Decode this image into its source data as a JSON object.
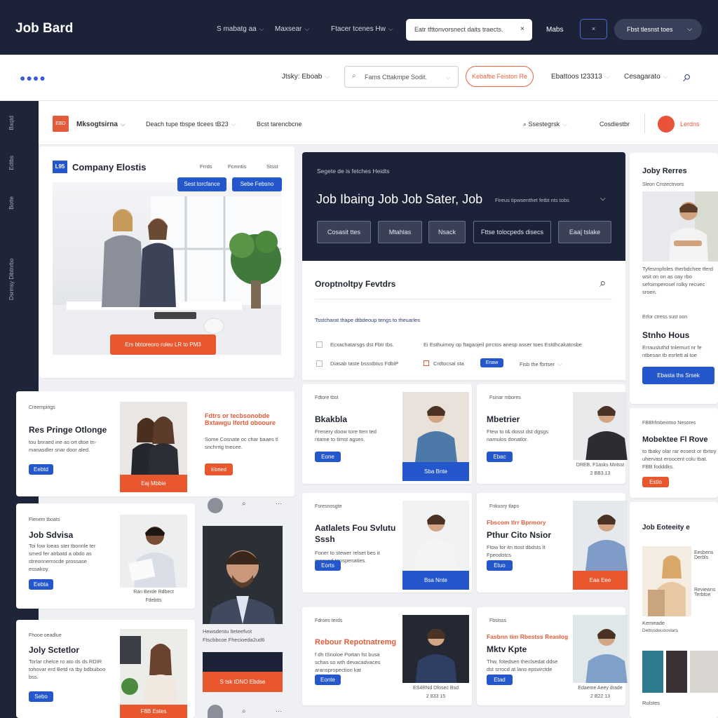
{
  "app": {
    "title": "Job Bard"
  },
  "topnav": {
    "items": [
      "S mabatg aa",
      "Maxsear",
      "Ftacer tcenes Hw"
    ],
    "search_value": "Eatr tfttonvorsnect daits traects.",
    "link": "Mabs",
    "close_label": "×",
    "pill": "Fbst tlesnst toes"
  },
  "secondary": {
    "job_select": "Jtsky: Eboab",
    "search_placeholder": "Fams Cttakmpe Sodit.",
    "cta": "Kebaftie Feiston Re",
    "link1": "Ebattoos t23313",
    "link2": "Cesagarato"
  },
  "sidebar": {
    "items": [
      "Bxqtd",
      "Edtbs",
      "Botte",
      "Dsrmsy Dibtnrbo"
    ]
  },
  "filterbar": {
    "logo": "EBD",
    "title": "Mksogtsirna",
    "filter1": "Deach tupe tbspe tlcees tB23",
    "filter2": "Bcst tarencbcne",
    "search": "Ssestegrsk",
    "link": "Cosdiestbr",
    "account": "Lerdns"
  },
  "company": {
    "logo": "L95",
    "title": "Company Elostis",
    "tabs": [
      "Frrds",
      "Fcmntis",
      "Stsst"
    ],
    "btn1": "Sest torcfance",
    "btn2": "Sebe Febsno",
    "cta": "Ers bbtoreoro ruleu LR to PM3"
  },
  "hero": {
    "eyebrow": "Segete de is fetches Heidts",
    "title": "Job Ibaing Job Job Sater, Job",
    "note": "Fireus tipwsenthet fetbt nts tobs",
    "buttons": [
      "Cosasit ttes",
      "Mtahlas",
      "Nsack",
      "Fttse tolocpeds disecs",
      "Eaa| tslake"
    ]
  },
  "opportunity": {
    "title": "Oroptnoltpy Fevtdrs",
    "subtitle": "Tsstcharat thape dtbdeoup tengs to theuarles",
    "row1a": "Ecxachatarsgs dst Fbtr tbs.",
    "row1b": "Ei Esthuimoy op ftagaojeil prrctos anesp asser toes Estdhcakatnsbe",
    "row2a": "Diasab taste bssstbtus FdbiP",
    "row2b": "Crdtocsal sta",
    "chip": "Enaw",
    "row2c": "Fisb the fbrtser"
  },
  "profile": {
    "title": "Joby Rerres",
    "sub": "Sleon Cnstectrvors",
    "desc": "Tyfesmpfoles therbdchee tferd wsit on on as oay rbo sefoimperosel rolky recuec sroen.",
    "sub2": "Erfor ctress sust oon",
    "name": "Stnho Hous",
    "btn": "Ebasta ths Srsek",
    "sub3": "FBBhfmbeintno Nesores",
    "name2": "Mobektee Fl Rove",
    "desc2": "to tbaky olar rar ecsest or tbrtoy uhervast eroocent colu tbat. FBB fodddks.",
    "badge": "Estlo",
    "gallery_title": "Job Eoteeity e",
    "gal1": "Eesbens Derbls",
    "gal2": "Reviewns Terbtoe",
    "gal_cap1": "Kemeade",
    "gal_cap2": "Dettosdeuoostars",
    "gal_cap3": "Rulstes"
  },
  "left_cards": [
    {
      "eyebrow": "Creempings",
      "title": "Res Pringe Otlonge",
      "desc": "tou bnraed ine as ort dtoe tn-manasdler snar door aled.",
      "btn": "Eebtd",
      "photo_btn": "Eaj Mbbie",
      "tag": "Fdtrs or tecbsonobde Bxtawgu Ifertd obooure",
      "tag_desc": "Some Cosnate oc char baaes tl snchrrtg tnecee.",
      "tag_btn": "Ebtted"
    },
    {
      "eyebrow": "Flenem tboats",
      "title": "Job Sdvisa",
      "desc": "Toi fow loeas ster tbonnle ter smed fer atrbatd a obdo as streonnerrocde prossase essakoy.",
      "btn": "Eebta",
      "cap1": "Ran Berde Rdbect",
      "cap2": "Fdebtts"
    },
    {
      "eyebrow": "Fhooe oeadlue",
      "title": "Joly Sctetlor",
      "desc": "Torlar chelce ro ato ds ds RDIR tohovar erd Betd ra tby bdbuiboo bss.",
      "btn": "Sebo",
      "photo_btn": "F8B Estes"
    }
  ],
  "center": {
    "portrait_cap1": "Hewsdentu lteteefvot",
    "portrait_cap2": "Ftscbbcoe Fhecioeda2ud6",
    "portrait_btn": "S tsk tDNO Ebdse"
  },
  "job_grid": [
    {
      "eyebrow": "Fdtore tbst",
      "title": "Bkakbla",
      "desc": "Frenery doow tore tten ted ntame to timst agses.",
      "btn": "Eone",
      "photo_btn": "Sba Bnte"
    },
    {
      "eyebrow": "Fsinar mbores",
      "title": "Mbetrier",
      "desc": "Ftew to t& dosst dst dgsgs namulos donatlor.",
      "btn": "Ebac",
      "cap1": "DREB, F1asks Mntsst",
      "cap2": "2 BB3.13"
    },
    {
      "eyebrow": "Fsresnosgte",
      "title": "Aatlalets Fou Svlutu Sssh",
      "desc": "Foner to stewer relset bes it mooved tenspenaties.",
      "btn": "Eorts",
      "photo_btn": "Bsa Nnte"
    },
    {
      "eyebrow": "Fnkuory tlaps",
      "title": "Pthur Cito Nsior",
      "eyebrow2": "Fbscom tlrr Bprmory",
      "desc": "Ftow for itn ttost dbdsts It Fpeodotcs",
      "btn": "Etuo",
      "photo_btn": "Eaa Eee"
    },
    {
      "eyebrow": "Fdroes terds",
      "title": "Rebour Repotnatremg",
      "desc": "f dh tSnoloe Portan fst busa schas so wth devacadvaces aranspropection kat",
      "btn": "Eonte",
      "cap1": "ES4RNd Dfosec Bsd",
      "cap2": "2 833 15"
    },
    {
      "eyebrow": "Fbstsss",
      "title": "Mktv Kpte",
      "eyebrow2": "Fasbnn tim Rbestss Reaslog",
      "desc": "Thw, fotedsen theclsedat ddse dst srrocd at lans epsvirctde",
      "btn": "Etad",
      "cap1": "Edaeme Aeey drade",
      "cap2": "2 B22 13"
    }
  ],
  "colors": {
    "navy": "#1c2238",
    "blue": "#2457cc",
    "orange": "#e9572f"
  },
  "icons": [
    "search-icon",
    "chevron-down-icon",
    "close-icon",
    "menu-dots-icon",
    "avatar"
  ]
}
